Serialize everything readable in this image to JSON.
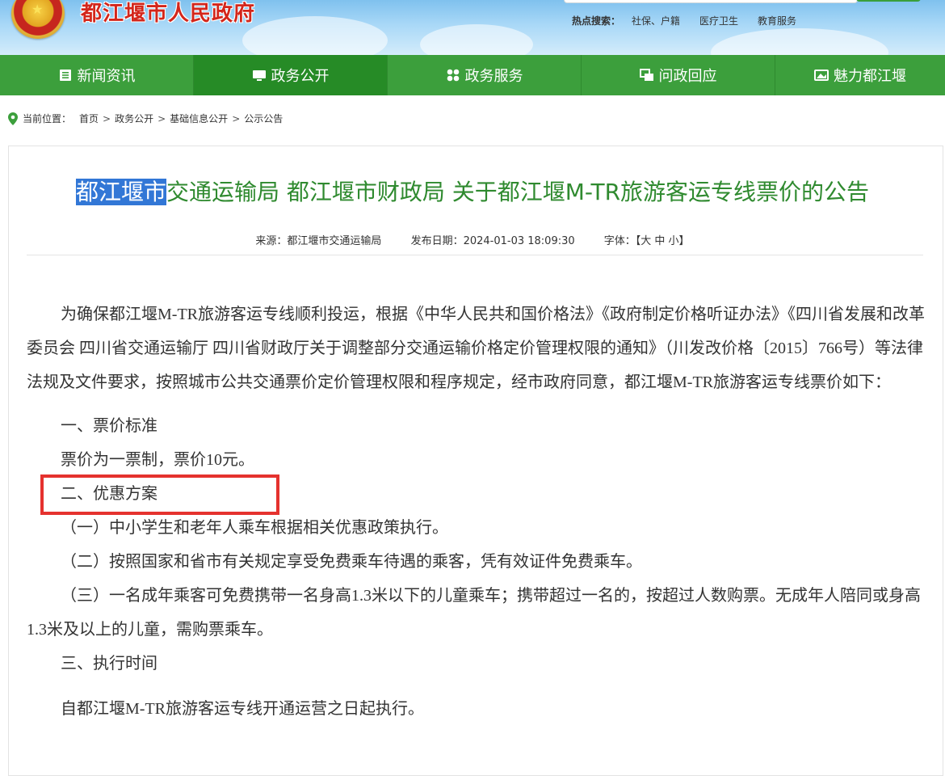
{
  "header": {
    "site_title": "都江堰市人民政府",
    "hot_label": "热点搜索：",
    "hot_links": [
      "社保、户籍",
      "医疗卫生",
      "教育服务"
    ]
  },
  "nav": {
    "items": [
      {
        "label": "新闻资讯",
        "icon": "newspaper-icon"
      },
      {
        "label": "政务公开",
        "icon": "monitor-icon"
      },
      {
        "label": "政务服务",
        "icon": "grid-icon"
      },
      {
        "label": "问政回应",
        "icon": "chat-icon"
      },
      {
        "label": "魅力都江堰",
        "icon": "picture-icon"
      }
    ],
    "active_index": 1
  },
  "breadcrumb": {
    "label": "当前位置：",
    "items": [
      "首页",
      "政务公开",
      "基础信息公开",
      "公示公告"
    ]
  },
  "article": {
    "title_highlight": "都江堰市",
    "title_rest": "交通运输局 都江堰市财政局 关于都江堰M-TR旅游客运专线票价的公告",
    "source": "来源：都江堰市交通运输局",
    "date": "发布日期：2024-01-03 18:09:30",
    "font_label": "字体：【大 中 小】",
    "paragraphs": [
      "为确保都江堰M-TR旅游客运专线顺利投运，根据《中华人民共和国价格法》《政府制定价格听证办法》《四川省发展和改革委员会 四川省交通运输厅 四川省财政厅关于调整部分交通运输价格定价管理权限的通知》（川发改价格〔2015〕766号）等法律法规及文件要求，按照城市公共交通票价定价管理权限和程序规定，经市政府同意，都江堰M-TR旅游客运专线票价如下：",
      "一、票价标准",
      "票价为一票制，票价10元。",
      "二、优惠方案",
      "（一）中小学生和老年人乘车根据相关优惠政策执行。",
      "（二）按照国家和省市有关规定享受免费乘车待遇的乘客，凭有效证件免费乘车。",
      "（三）一名成年乘客可免费携带一名身高1.3米以下的儿童乘车；携带超过一名的，按超过人数购票。无成年人陪同或身高1.3米及以上的儿童，需购票乘车。",
      "三、执行时间",
      "自都江堰M-TR旅游客运专线开通运营之日起执行。"
    ]
  },
  "colors": {
    "nav_green": "#3c9f3c",
    "nav_active": "#268b26",
    "title_green": "#2f8a2f",
    "site_red": "#d3261b",
    "highlight_blue": "#3277d6",
    "annotation_red": "#e5322e"
  }
}
